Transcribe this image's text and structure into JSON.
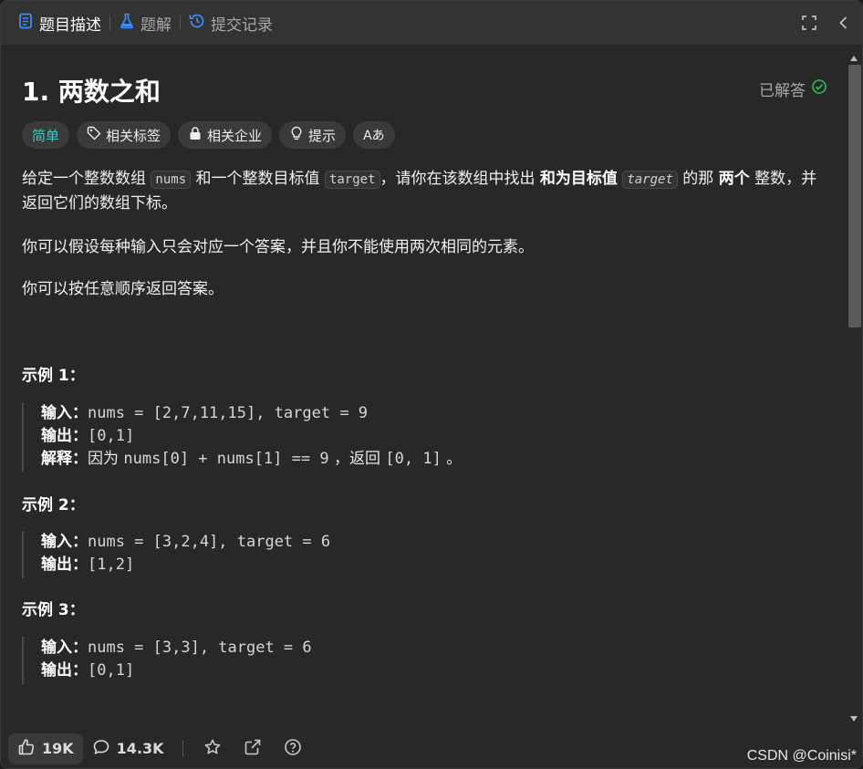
{
  "tabs": [
    {
      "label": "题目描述",
      "icon": "description-icon",
      "active": true
    },
    {
      "label": "题解",
      "icon": "flask-icon",
      "active": false
    },
    {
      "label": "提交记录",
      "icon": "history-icon",
      "active": false
    }
  ],
  "problem": {
    "title": "1. 两数之和",
    "status": "已解答"
  },
  "tags": {
    "difficulty": "简单",
    "related_tags": "相关标签",
    "related_companies": "相关企业",
    "hint": "提示",
    "translate": "Aあ"
  },
  "description": {
    "p1_a": "给定一个整数数组 ",
    "p1_code1": "nums",
    "p1_b": " 和一个整数目标值 ",
    "p1_code2": "target",
    "p1_c": "，请你在该数组中找出 ",
    "p1_bold1": "和为目标值",
    "p1_code3": "target",
    "p1_d": " 的那 ",
    "p1_bold2": "两个",
    "p1_e": " 整数，并返回它们的数组下标。",
    "p2": "你可以假设每种输入只会对应一个答案，并且你不能使用两次相同的元素。",
    "p3": "你可以按任意顺序返回答案。"
  },
  "examples": [
    {
      "title": "示例 1：",
      "input_label": "输入：",
      "input": "nums = [2,7,11,15], target = 9",
      "output_label": "输出：",
      "output": "[0,1]",
      "explain_label": "解释：",
      "explain_a": "因为 ",
      "explain_code": "nums[0] + nums[1] == 9",
      "explain_b": " ，返回 ",
      "explain_code2": "[0, 1]",
      "explain_c": " 。"
    },
    {
      "title": "示例 2：",
      "input_label": "输入：",
      "input": "nums = [3,2,4], target = 6",
      "output_label": "输出：",
      "output": "[1,2]"
    },
    {
      "title": "示例 3：",
      "input_label": "输入：",
      "input": "nums = [3,3], target = 6",
      "output_label": "输出：",
      "output": "[0,1]"
    }
  ],
  "footer": {
    "likes": "19K",
    "comments": "14.3K"
  },
  "watermark": "CSDN @Coinisi*",
  "colors": {
    "accent_blue": "#3c8cff",
    "easy": "#46c6c2",
    "solved_green": "#2cbb5d"
  }
}
